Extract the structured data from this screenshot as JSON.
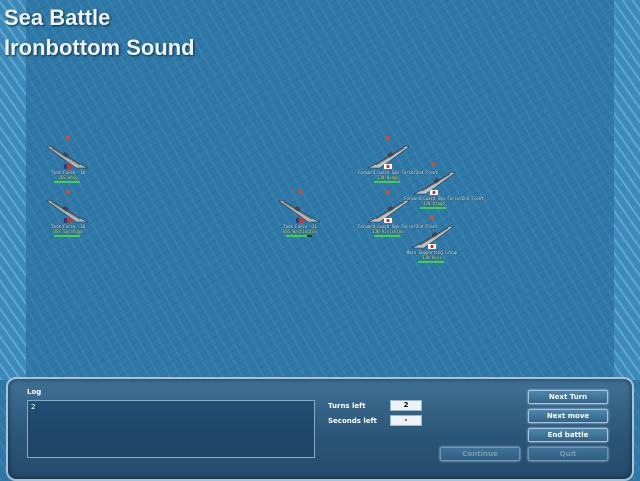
{
  "title": {
    "line1": "Sea Battle",
    "line2": "Ironbottom Sound"
  },
  "colors": {
    "sea": "#2f79a8",
    "panel": "#2c5779",
    "hp": "#3cd24c",
    "label2": "#e8e85a"
  },
  "ships": [
    {
      "id": "us1",
      "side": "us",
      "heading": "right",
      "label1": "Task Force -18",
      "label2": "USS Wasp",
      "hp": 1.0
    },
    {
      "id": "us2",
      "side": "us",
      "heading": "right",
      "label1": "Task Force -18",
      "label2": "USS Saratoga",
      "hp": 1.0
    },
    {
      "id": "us3",
      "side": "us",
      "heading": "right",
      "label1": "Task Force -11",
      "label2": "USS Washington",
      "hp": 0.8
    },
    {
      "id": "jp1",
      "side": "jp",
      "heading": "left",
      "label1": "Forward Guard Sqn Force/2nd Fleet",
      "label2": "IJN Kongo",
      "hp": 1.0
    },
    {
      "id": "jp2",
      "side": "jp",
      "heading": "left",
      "label1": "Forward Guard Sqn Force/2nd Fleet",
      "label2": "IJN Atago",
      "hp": 1.0
    },
    {
      "id": "jp3",
      "side": "jp",
      "heading": "left",
      "label1": "Forward Guard Sqn Force/2nd Fleet",
      "label2": "IJN Kirishima",
      "hp": 1.0
    },
    {
      "id": "jp4",
      "side": "jp",
      "heading": "left",
      "label1": "Main Supporting Group",
      "label2": "IJN Hiei",
      "hp": 1.0
    }
  ],
  "panel": {
    "log_label": "Log",
    "log_text": "2",
    "turns_label": "Turns left",
    "turns_value": "2",
    "seconds_label": "Seconds left",
    "seconds_value": "-",
    "buttons": {
      "next_turn": "Next Turn",
      "next_move": "Next move",
      "end_battle": "End battle",
      "disabled_left": "Continue",
      "disabled_right": "Quit"
    }
  }
}
